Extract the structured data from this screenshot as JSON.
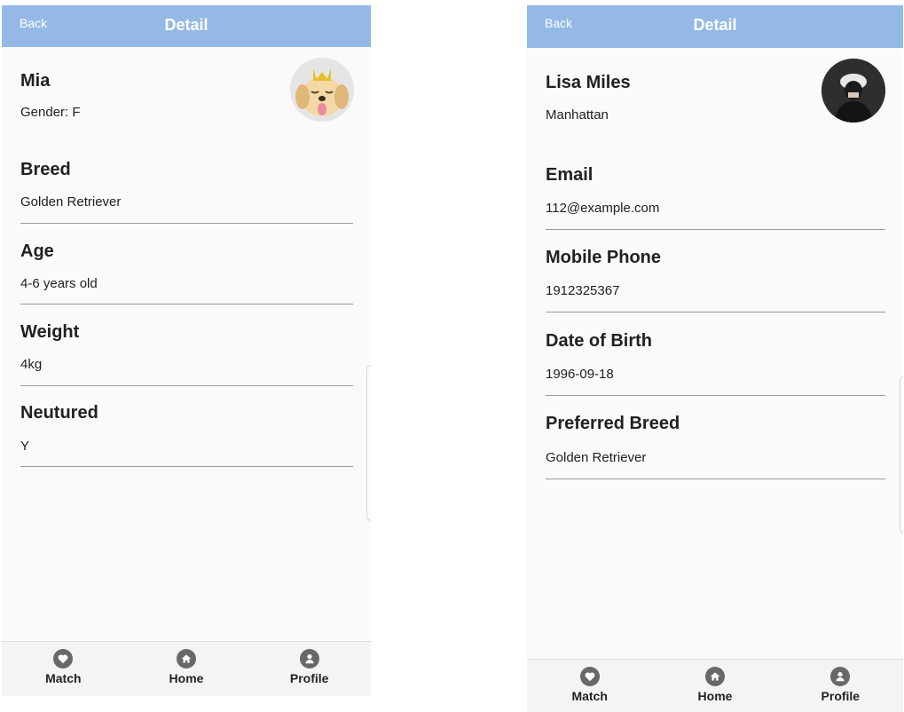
{
  "app": {
    "back_label": "Back",
    "title": "Detail"
  },
  "pet": {
    "name": "Mia",
    "gender": "Gender: F",
    "fields": [
      {
        "label": "Breed",
        "value": "Golden Retriever"
      },
      {
        "label": "Age",
        "value": "4-6 years old"
      },
      {
        "label": "Weight",
        "value": "4kg"
      },
      {
        "label": "Neutured",
        "value": "Y"
      }
    ]
  },
  "user": {
    "name": "Lisa Miles",
    "location": "Manhattan",
    "fields": [
      {
        "label": "Email",
        "value": "112@example.com"
      },
      {
        "label": "Mobile Phone",
        "value": "1912325367"
      },
      {
        "label": "Date of Birth",
        "value": "1996-09-18"
      },
      {
        "label": "Preferred Breed",
        "value": "Golden Retriever"
      }
    ]
  },
  "tabs": [
    {
      "label": "Match",
      "icon": "heart-icon"
    },
    {
      "label": "Home",
      "icon": "home-icon"
    },
    {
      "label": "Profile",
      "icon": "person-icon"
    }
  ],
  "colors": {
    "header": "#94b9e6",
    "tab_icon": "#686868",
    "divider": "#9a9a9a",
    "background": "#fafafa"
  }
}
